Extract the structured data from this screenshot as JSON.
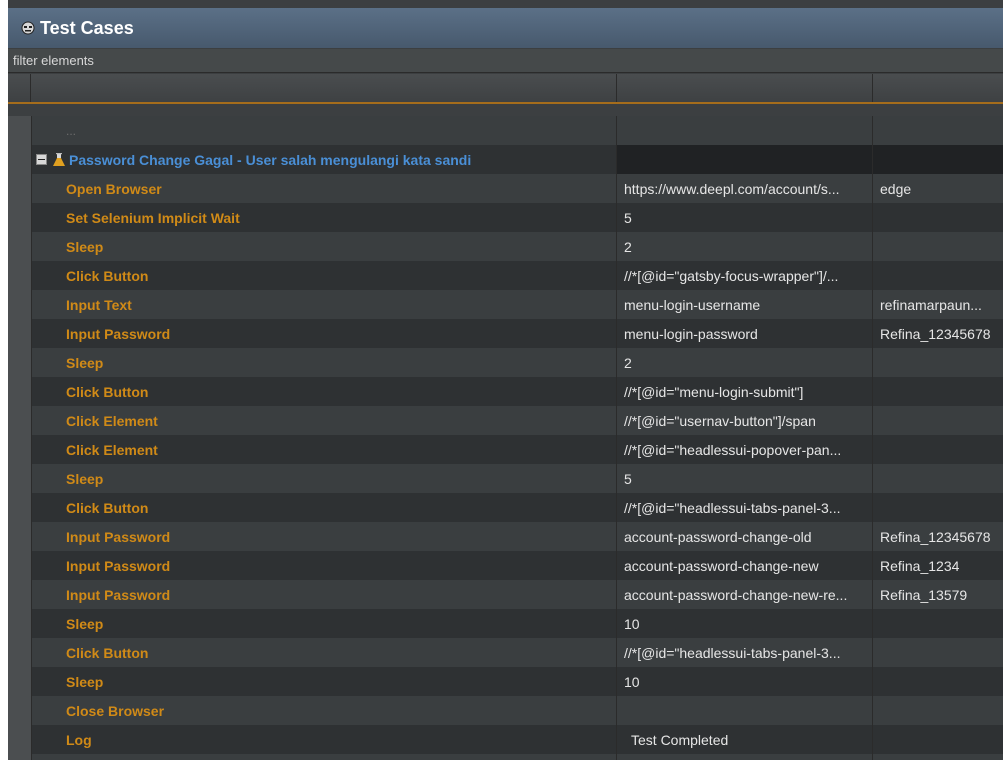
{
  "window": {
    "title": "Test Cases"
  },
  "filter": {
    "placeholder": "filter elements"
  },
  "testcase": {
    "name": "Password Change Gagal - User salah mengulangi kata sandi"
  },
  "ellipsis": "...",
  "steps": [
    {
      "keyword": "Open Browser",
      "arg1": "https://www.deepl.com/account/s...",
      "arg2": "edge"
    },
    {
      "keyword": "Set Selenium Implicit Wait",
      "arg1": "5",
      "arg2": ""
    },
    {
      "keyword": "Sleep",
      "arg1": "2",
      "arg2": ""
    },
    {
      "keyword": "Click Button",
      "arg1": "//*[@id=\"gatsby-focus-wrapper\"]/...",
      "arg2": ""
    },
    {
      "keyword": "Input Text",
      "arg1": "menu-login-username",
      "arg2": "refinamarpaun..."
    },
    {
      "keyword": "Input Password",
      "arg1": "menu-login-password",
      "arg2": "Refina_12345678"
    },
    {
      "keyword": "Sleep",
      "arg1": "2",
      "arg2": ""
    },
    {
      "keyword": "Click Button",
      "arg1": "//*[@id=\"menu-login-submit\"]",
      "arg2": ""
    },
    {
      "keyword": "Click Element",
      "arg1": "//*[@id=\"usernav-button\"]/span",
      "arg2": ""
    },
    {
      "keyword": "Click Element",
      "arg1": "//*[@id=\"headlessui-popover-pan...",
      "arg2": ""
    },
    {
      "keyword": "Sleep",
      "arg1": "5",
      "arg2": ""
    },
    {
      "keyword": "Click Button",
      "arg1": "//*[@id=\"headlessui-tabs-panel-3...",
      "arg2": ""
    },
    {
      "keyword": "Input Password",
      "arg1": "account-password-change-old",
      "arg2": "Refina_12345678"
    },
    {
      "keyword": "Input Password",
      "arg1": "account-password-change-new",
      "arg2": "Refina_1234"
    },
    {
      "keyword": "Input Password",
      "arg1": "account-password-change-new-re...",
      "arg2": "Refina_13579"
    },
    {
      "keyword": "Sleep",
      "arg1": "10",
      "arg2": ""
    },
    {
      "keyword": "Click Button",
      "arg1": "//*[@id=\"headlessui-tabs-panel-3...",
      "arg2": ""
    },
    {
      "keyword": "Sleep",
      "arg1": "10",
      "arg2": ""
    },
    {
      "keyword": "Close Browser",
      "arg1": "",
      "arg2": ""
    },
    {
      "keyword": "Log",
      "arg1": "Test Completed",
      "arg2": ""
    }
  ],
  "colors": {
    "keyword": "#d08a17",
    "testcase": "#4a8fd6",
    "header_accent": "#a56d1c",
    "titlebar": "#51657b"
  },
  "icons": {
    "title": "test-cases-icon",
    "testcase": "flask-icon",
    "toggle": "collapse-icon"
  }
}
